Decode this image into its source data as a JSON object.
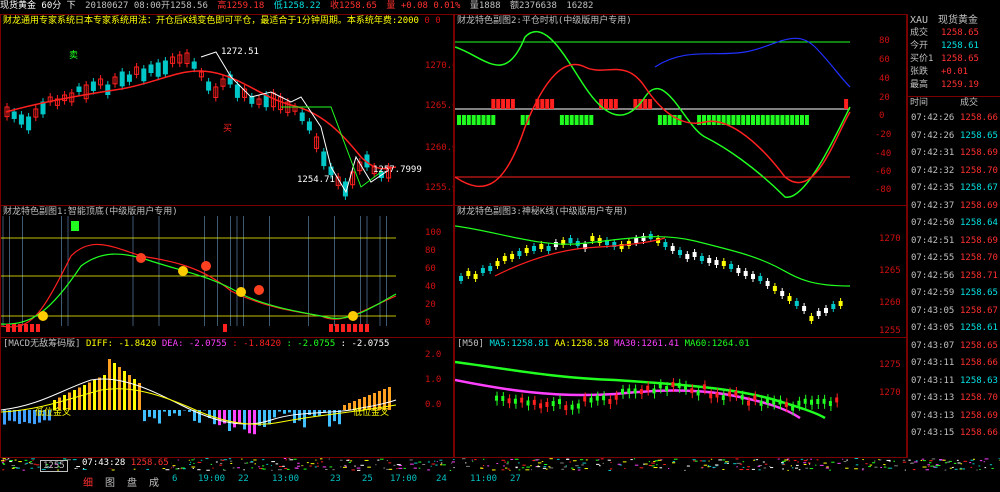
{
  "topbar": {
    "items": [
      "现货黄金 60分 下",
      "20180627 08:00开1258.56",
      "高1259.18",
      "低1258.22",
      "收1258.65",
      "量 +0.08 0.01%",
      "量1888",
      "额2376638",
      "16282"
    ]
  },
  "panels": {
    "main": {
      "title": "财龙通用专家系统",
      "subtitle": "日本专家系统用法：开仓后K线变色即可平仓，最适合于1分钟周期。本系统年费:2000",
      "extra": "0 0",
      "axis": [
        "1270.0",
        "1265.0",
        "1260.0",
        "1255.0"
      ],
      "annotations": [
        "1272.51",
        "1254.71",
        "1257.7999",
        "卖",
        "买"
      ]
    },
    "sub2": {
      "title": "财龙特色副图2:平仓时机(中级版用户专用)",
      "axis": [
        "80",
        "60",
        "40",
        "20",
        "0",
        "-20",
        "-40",
        "-60",
        "-80"
      ]
    },
    "sub1": {
      "title": "财龙特色副图1:智能顶底(中级版用户专用)",
      "axis": [
        "100",
        "80",
        "60",
        "40",
        "20",
        "0"
      ]
    },
    "sub3": {
      "title": "财龙特色副图3:神秘K线(中级版用户专用)",
      "axis": [
        "1270",
        "1265",
        "1260",
        "1255"
      ]
    },
    "macd": {
      "title": "[MACD无敌筹码版]",
      "diff": "DIFF: -1.8420",
      "dea": "DEA: -2.0755",
      "v1": ": -1.8420",
      "v2": ": -2.0755",
      "v3": ": -2.0755",
      "axis": [
        "2.0",
        "1.0",
        "0.0"
      ],
      "label": "低位金叉"
    },
    "m50": {
      "title": "[M50]",
      "ma5": "MA5:1258.81",
      "aa": "AA:1258.58",
      "ma30": "MA30:1261.41",
      "ma60": "MA60:1264.01",
      "axis": [
        "1275",
        "1270"
      ]
    }
  },
  "colors": {
    "up": "#ff2020",
    "down": "#00c8c8",
    "red": "#d01010",
    "yellow": "#ffff00",
    "green": "#20ff20",
    "magenta": "#ff40ff",
    "white": "#ffffff"
  },
  "right": {
    "header": {
      "code": "XAU",
      "name": "现货黄金"
    },
    "quotes": [
      {
        "k": "成交",
        "v": "1258.65",
        "c": "#ff3030"
      },
      {
        "k": "今开",
        "v": "1258.61",
        "c": "#00e0e0"
      },
      {
        "k": "买价1",
        "v": "1258.65",
        "c": "#ff3030"
      },
      {
        "k": "张跌",
        "v": "+0.01",
        "c": "#ff3030"
      },
      {
        "k": "最高",
        "v": "1259.19",
        "c": "#ff3030"
      }
    ],
    "tick_header": {
      "time": "时间",
      "price": "成交"
    },
    "ticks": [
      {
        "t": "07:42:26",
        "p": "1258.66",
        "c": "#ff3030"
      },
      {
        "t": "07:42:26",
        "p": "1258.65",
        "c": "#00e0e0"
      },
      {
        "t": "07:42:31",
        "p": "1258.69",
        "c": "#ff3030"
      },
      {
        "t": "07:42:32",
        "p": "1258.70",
        "c": "#ff3030"
      },
      {
        "t": "07:42:35",
        "p": "1258.67",
        "c": "#00e0e0"
      },
      {
        "t": "07:42:37",
        "p": "1258.69",
        "c": "#ff3030"
      },
      {
        "t": "07:42:50",
        "p": "1258.64",
        "c": "#00e0e0"
      },
      {
        "t": "07:42:51",
        "p": "1258.69",
        "c": "#ff3030"
      },
      {
        "t": "07:42:55",
        "p": "1258.70",
        "c": "#ff3030"
      },
      {
        "t": "07:42:56",
        "p": "1258.71",
        "c": "#ff3030"
      },
      {
        "t": "07:42:59",
        "p": "1258.65",
        "c": "#00e0e0"
      },
      {
        "t": "07:43:05",
        "p": "1258.67",
        "c": "#ff3030"
      },
      {
        "t": "07:43:05",
        "p": "1258.61",
        "c": "#00e0e0"
      },
      {
        "t": "07:43:07",
        "p": "1258.65",
        "c": "#ff3030"
      },
      {
        "t": "07:43:11",
        "p": "1258.66",
        "c": "#ff3030"
      },
      {
        "t": "07:43:11",
        "p": "1258.63",
        "c": "#00e0e0"
      },
      {
        "t": "07:43:13",
        "p": "1258.70",
        "c": "#ff3030"
      },
      {
        "t": "07:43:13",
        "p": "1258.69",
        "c": "#ff3030"
      },
      {
        "t": "07:43:15",
        "p": "1258.66",
        "c": "#ff3030"
      }
    ]
  },
  "bottom": {
    "cursor_time": "07:43:28",
    "cursor_price": "1258.65",
    "price_tag": "1255",
    "tabs": [
      "细",
      "图",
      "盘",
      "成"
    ],
    "times": [
      "6",
      "19:00",
      "22",
      "13:00",
      "23",
      "25",
      "17:00",
      "24",
      "11:00",
      "27"
    ]
  }
}
